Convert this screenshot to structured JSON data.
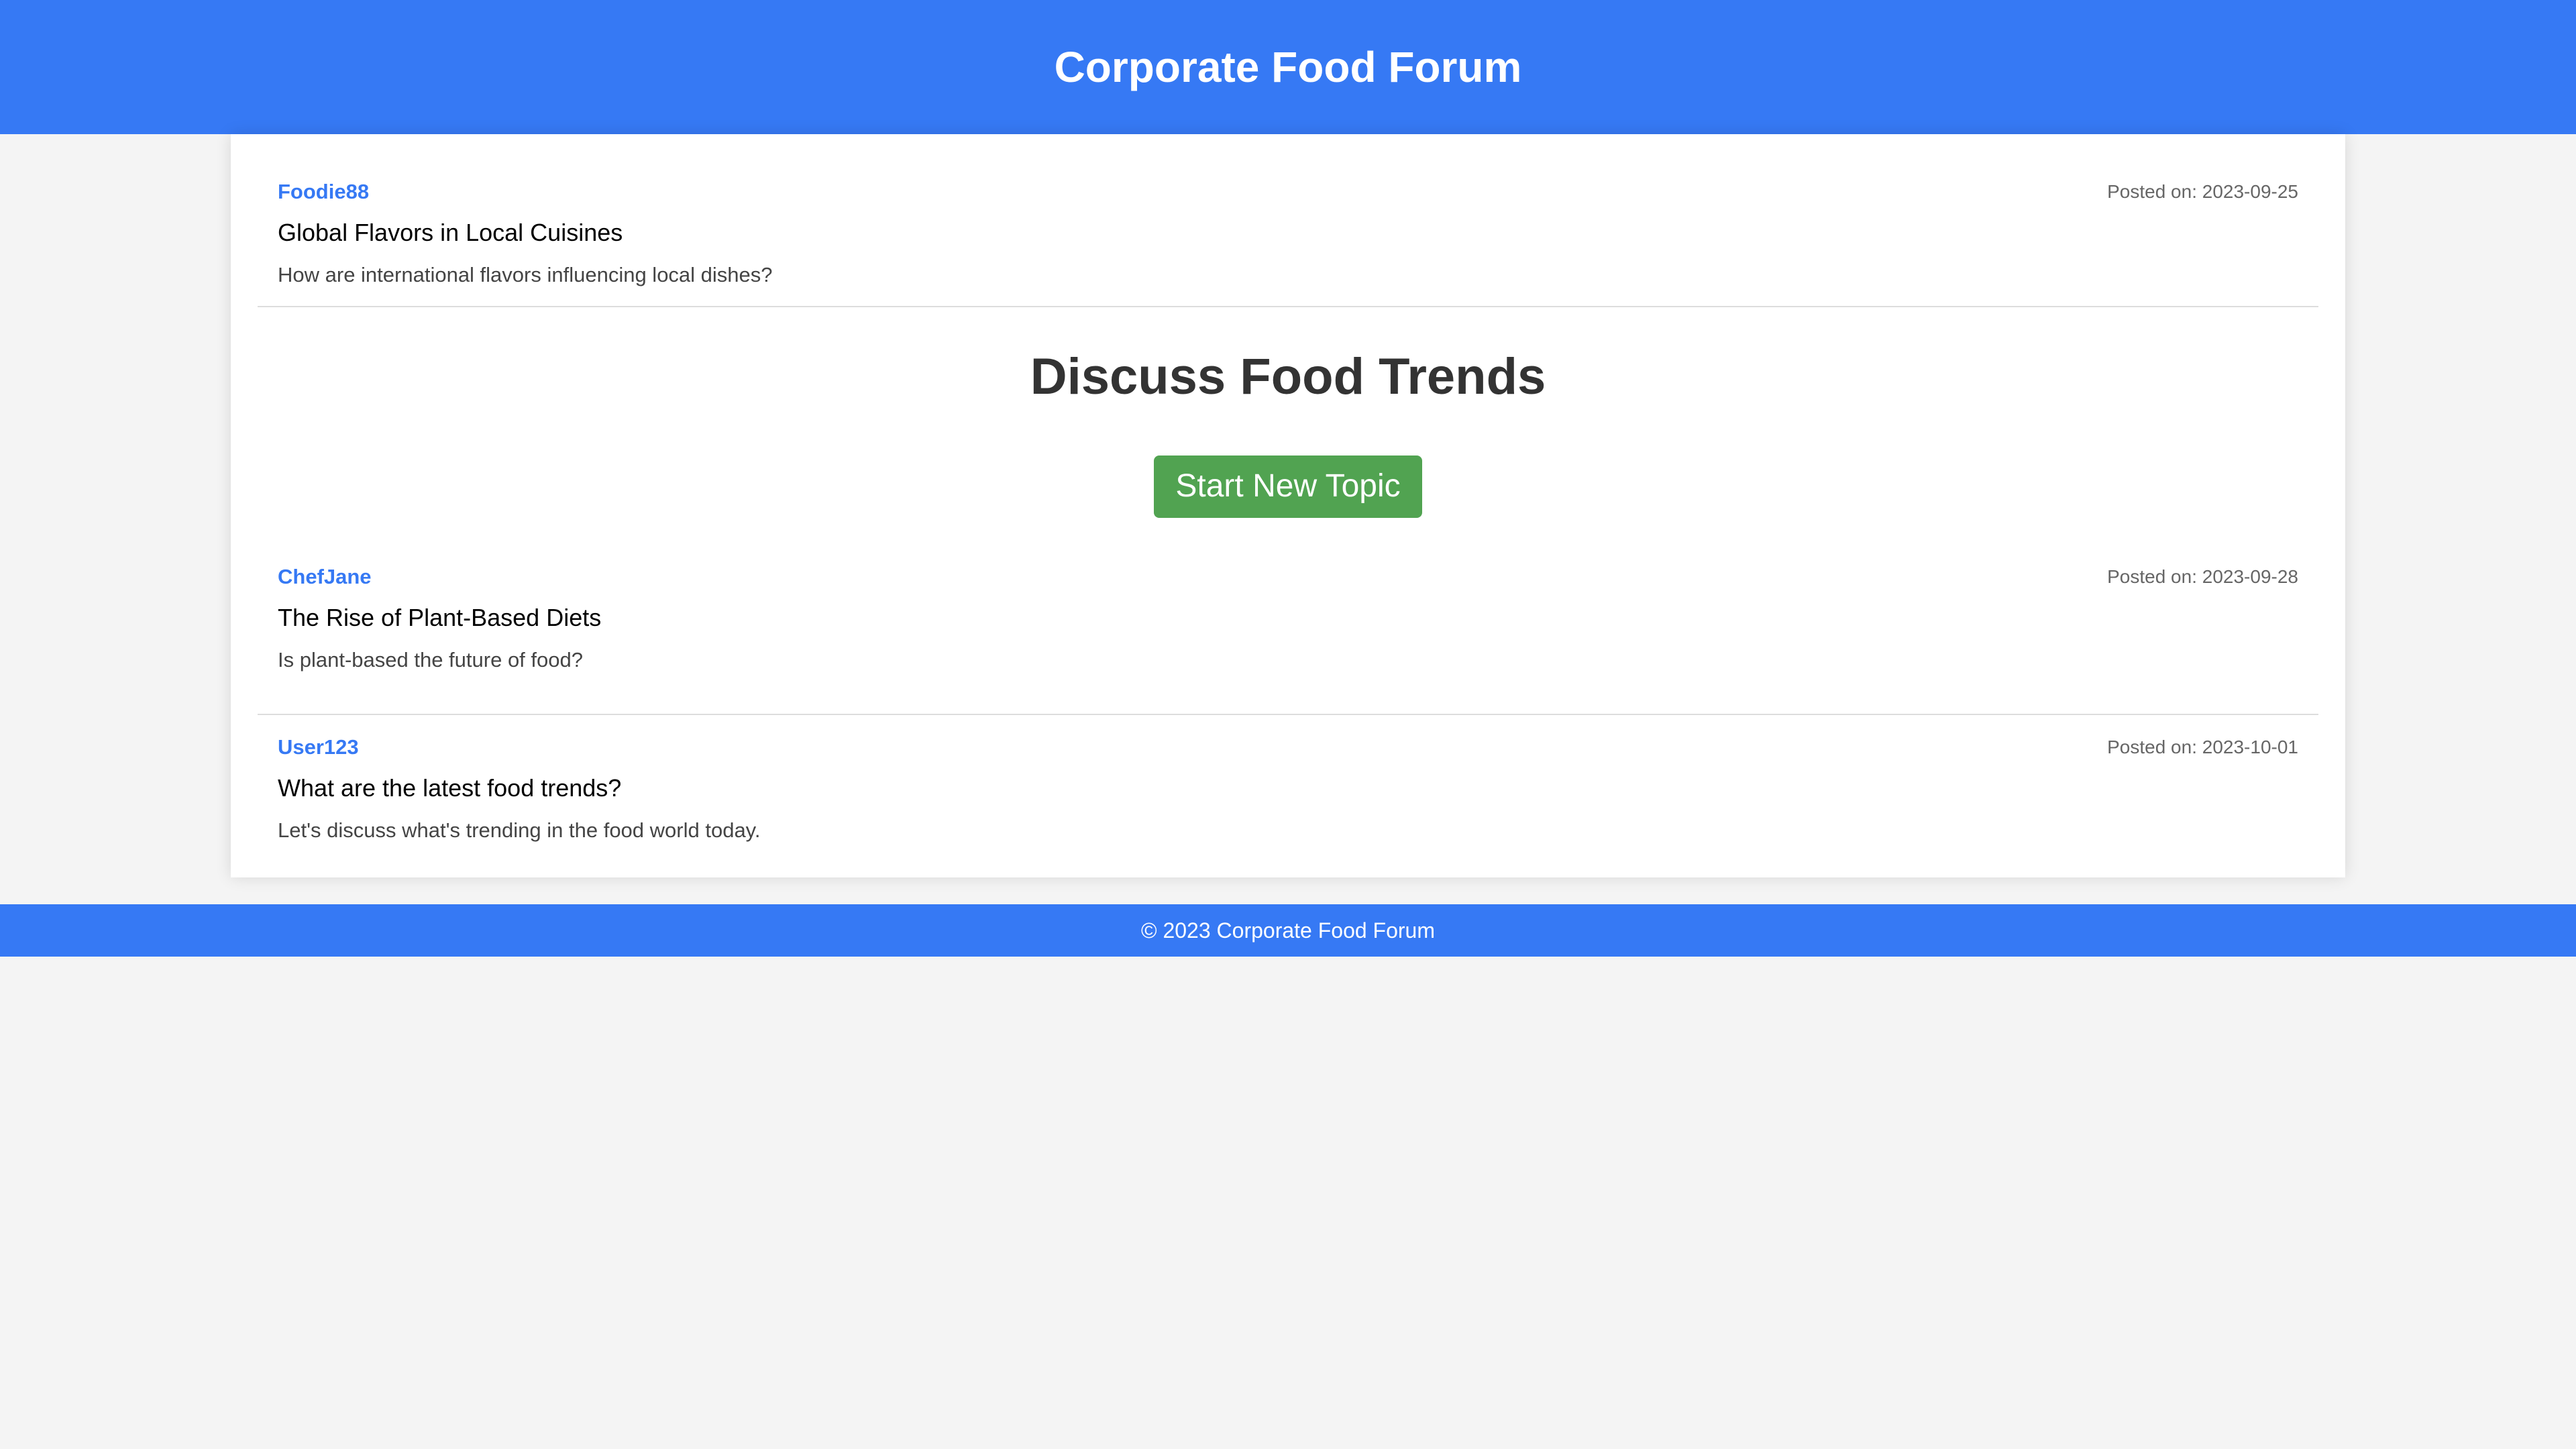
{
  "header": {
    "title": "Corporate Food Forum"
  },
  "main": {
    "heading": "Discuss Food Trends",
    "new_topic_label": "Start New Topic",
    "posts": [
      {
        "author": "Foodie88",
        "date": "Posted on: 2023-09-25",
        "title": "Global Flavors in Local Cuisines",
        "body": "How are international flavors influencing local dishes?"
      },
      {
        "author": "ChefJane",
        "date": "Posted on: 2023-09-28",
        "title": "The Rise of Plant-Based Diets",
        "body": "Is plant-based the future of food?"
      },
      {
        "author": "User123",
        "date": "Posted on: 2023-10-01",
        "title": "What are the latest food trends?",
        "body": "Let's discuss what's trending in the food world today."
      }
    ]
  },
  "footer": {
    "text": "© 2023 Corporate Food Forum"
  },
  "colors": {
    "brand": "#3679f4",
    "button": "#51a351",
    "background": "#f4f4f4"
  }
}
